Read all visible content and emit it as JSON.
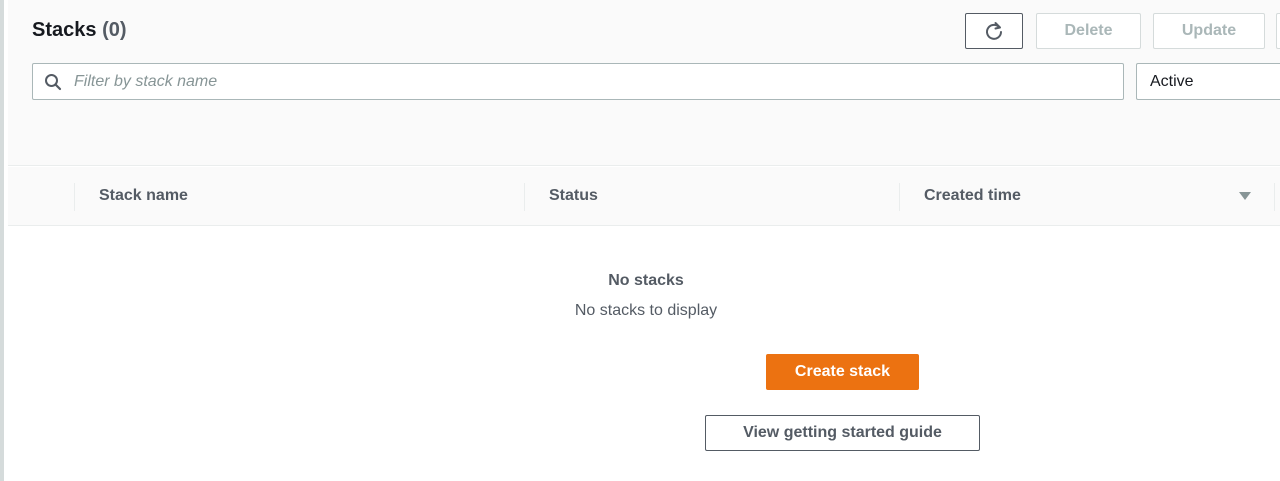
{
  "header": {
    "title": "Stacks",
    "count": "(0)"
  },
  "toolbar": {
    "refresh_icon": "refresh-icon",
    "delete_label": "Delete",
    "update_label": "Update"
  },
  "filter": {
    "placeholder": "Filter by stack name",
    "value": "",
    "status_selected": "Active"
  },
  "table": {
    "columns": [
      "Stack name",
      "Status",
      "Created time"
    ],
    "sort_icon": "caret-down-icon"
  },
  "empty_state": {
    "title": "No stacks",
    "subtitle": "No stacks to display",
    "primary_button": "Create stack",
    "secondary_button": "View getting started guide"
  },
  "colors": {
    "primary": "#ec7211",
    "text_secondary": "#545b64",
    "disabled": "#aab7b8"
  }
}
